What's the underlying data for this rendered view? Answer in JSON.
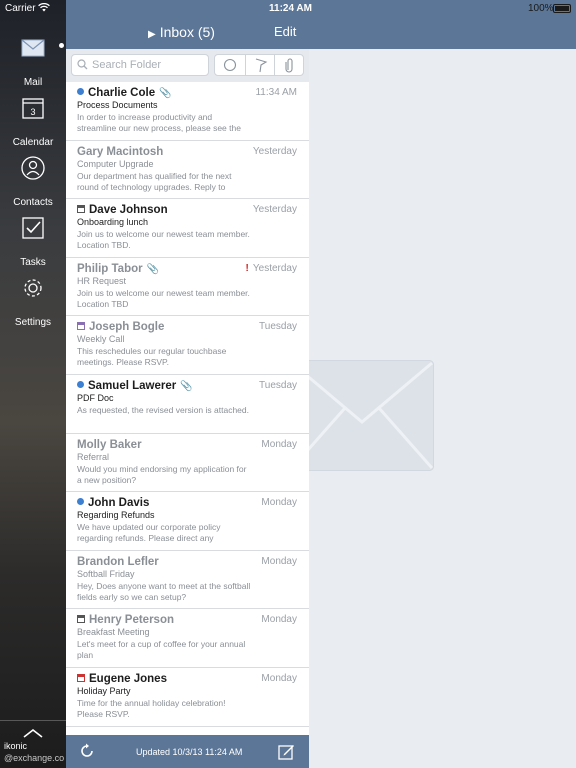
{
  "status_bar": {
    "carrier": "Carrier",
    "time": "11:24 AM",
    "battery": "100%"
  },
  "rail": {
    "items": [
      {
        "label": "Mail",
        "icon": "mail-icon"
      },
      {
        "label": "Calendar",
        "icon": "calendar-icon",
        "icon_text": "3"
      },
      {
        "label": "Contacts",
        "icon": "contacts-icon"
      },
      {
        "label": "Tasks",
        "icon": "tasks-icon"
      },
      {
        "label": "Settings",
        "icon": "settings-icon"
      }
    ],
    "account_name": "ikonic",
    "account_email": "@exchange.co"
  },
  "navbar": {
    "title": "Inbox (5)",
    "edit": "Edit"
  },
  "search": {
    "placeholder": "Search Folder"
  },
  "messages": [
    {
      "sender": "Charlie Cole",
      "subject": "Process Documents",
      "preview": "In order to increase productivity and streamline our new process, please see the",
      "date": "11:34 AM",
      "unread": true,
      "attachment": true
    },
    {
      "sender": "Gary Macintosh",
      "subject": "Computer Upgrade",
      "preview": "Our department has qualified for the next round of technology upgrades. Reply to",
      "date": "Yesterday",
      "unread": false
    },
    {
      "sender": "Dave Johnson",
      "subject": "Onboarding lunch",
      "preview": "Join us to welcome our newest team member. Location TBD.",
      "date": "Yesterday",
      "unread": true,
      "meeting": true
    },
    {
      "sender": "Philip Tabor",
      "subject": "HR Request",
      "preview": "Join us to welcome our newest team member. Location TBD",
      "date": "Yesterday",
      "unread": false,
      "attachment": true,
      "flag": "!"
    },
    {
      "sender": "Joseph Bogle",
      "subject": "Weekly Call",
      "preview": "This reschedules our regular touchbase meetings. Please RSVP.",
      "date": "Tuesday",
      "unread": false,
      "meeting": true
    },
    {
      "sender": "Samuel Lawerer",
      "subject": "PDF Doc",
      "preview": "As requested, the revised version is attached.",
      "date": "Tuesday",
      "unread": true,
      "attachment": true
    },
    {
      "sender": "Molly Baker",
      "subject": "Referral",
      "preview": "Would you mind endorsing my application for a new position?",
      "date": "Monday",
      "unread": false
    },
    {
      "sender": "John Davis",
      "subject": "Regarding Refunds",
      "preview": "We have updated our corporate policy regarding refunds. Please direct any",
      "date": "Monday",
      "unread": true
    },
    {
      "sender": "Brandon Lefler",
      "subject": "Softball Friday",
      "preview": "Hey, Does anyone want to meet at the softball fields early so we can setup?",
      "date": "Monday",
      "unread": false
    },
    {
      "sender": "Henry Peterson",
      "subject": "Breakfast Meeting",
      "preview": "Let's meet for a cup of coffee for your annual plan",
      "date": "Monday",
      "unread": false,
      "meeting": true
    },
    {
      "sender": "Eugene Jones",
      "subject": "Holiday Party",
      "preview": "Time for the annual holiday celebration! Please RSVP.",
      "date": "Monday",
      "unread": true,
      "meeting": true
    }
  ],
  "toolbar": {
    "updated": "Updated 10/3/13 11:24 AM"
  },
  "colors": {
    "bar": "#5c7697",
    "unread_dot": "#3d7fd0",
    "flag": "#cc2222"
  }
}
